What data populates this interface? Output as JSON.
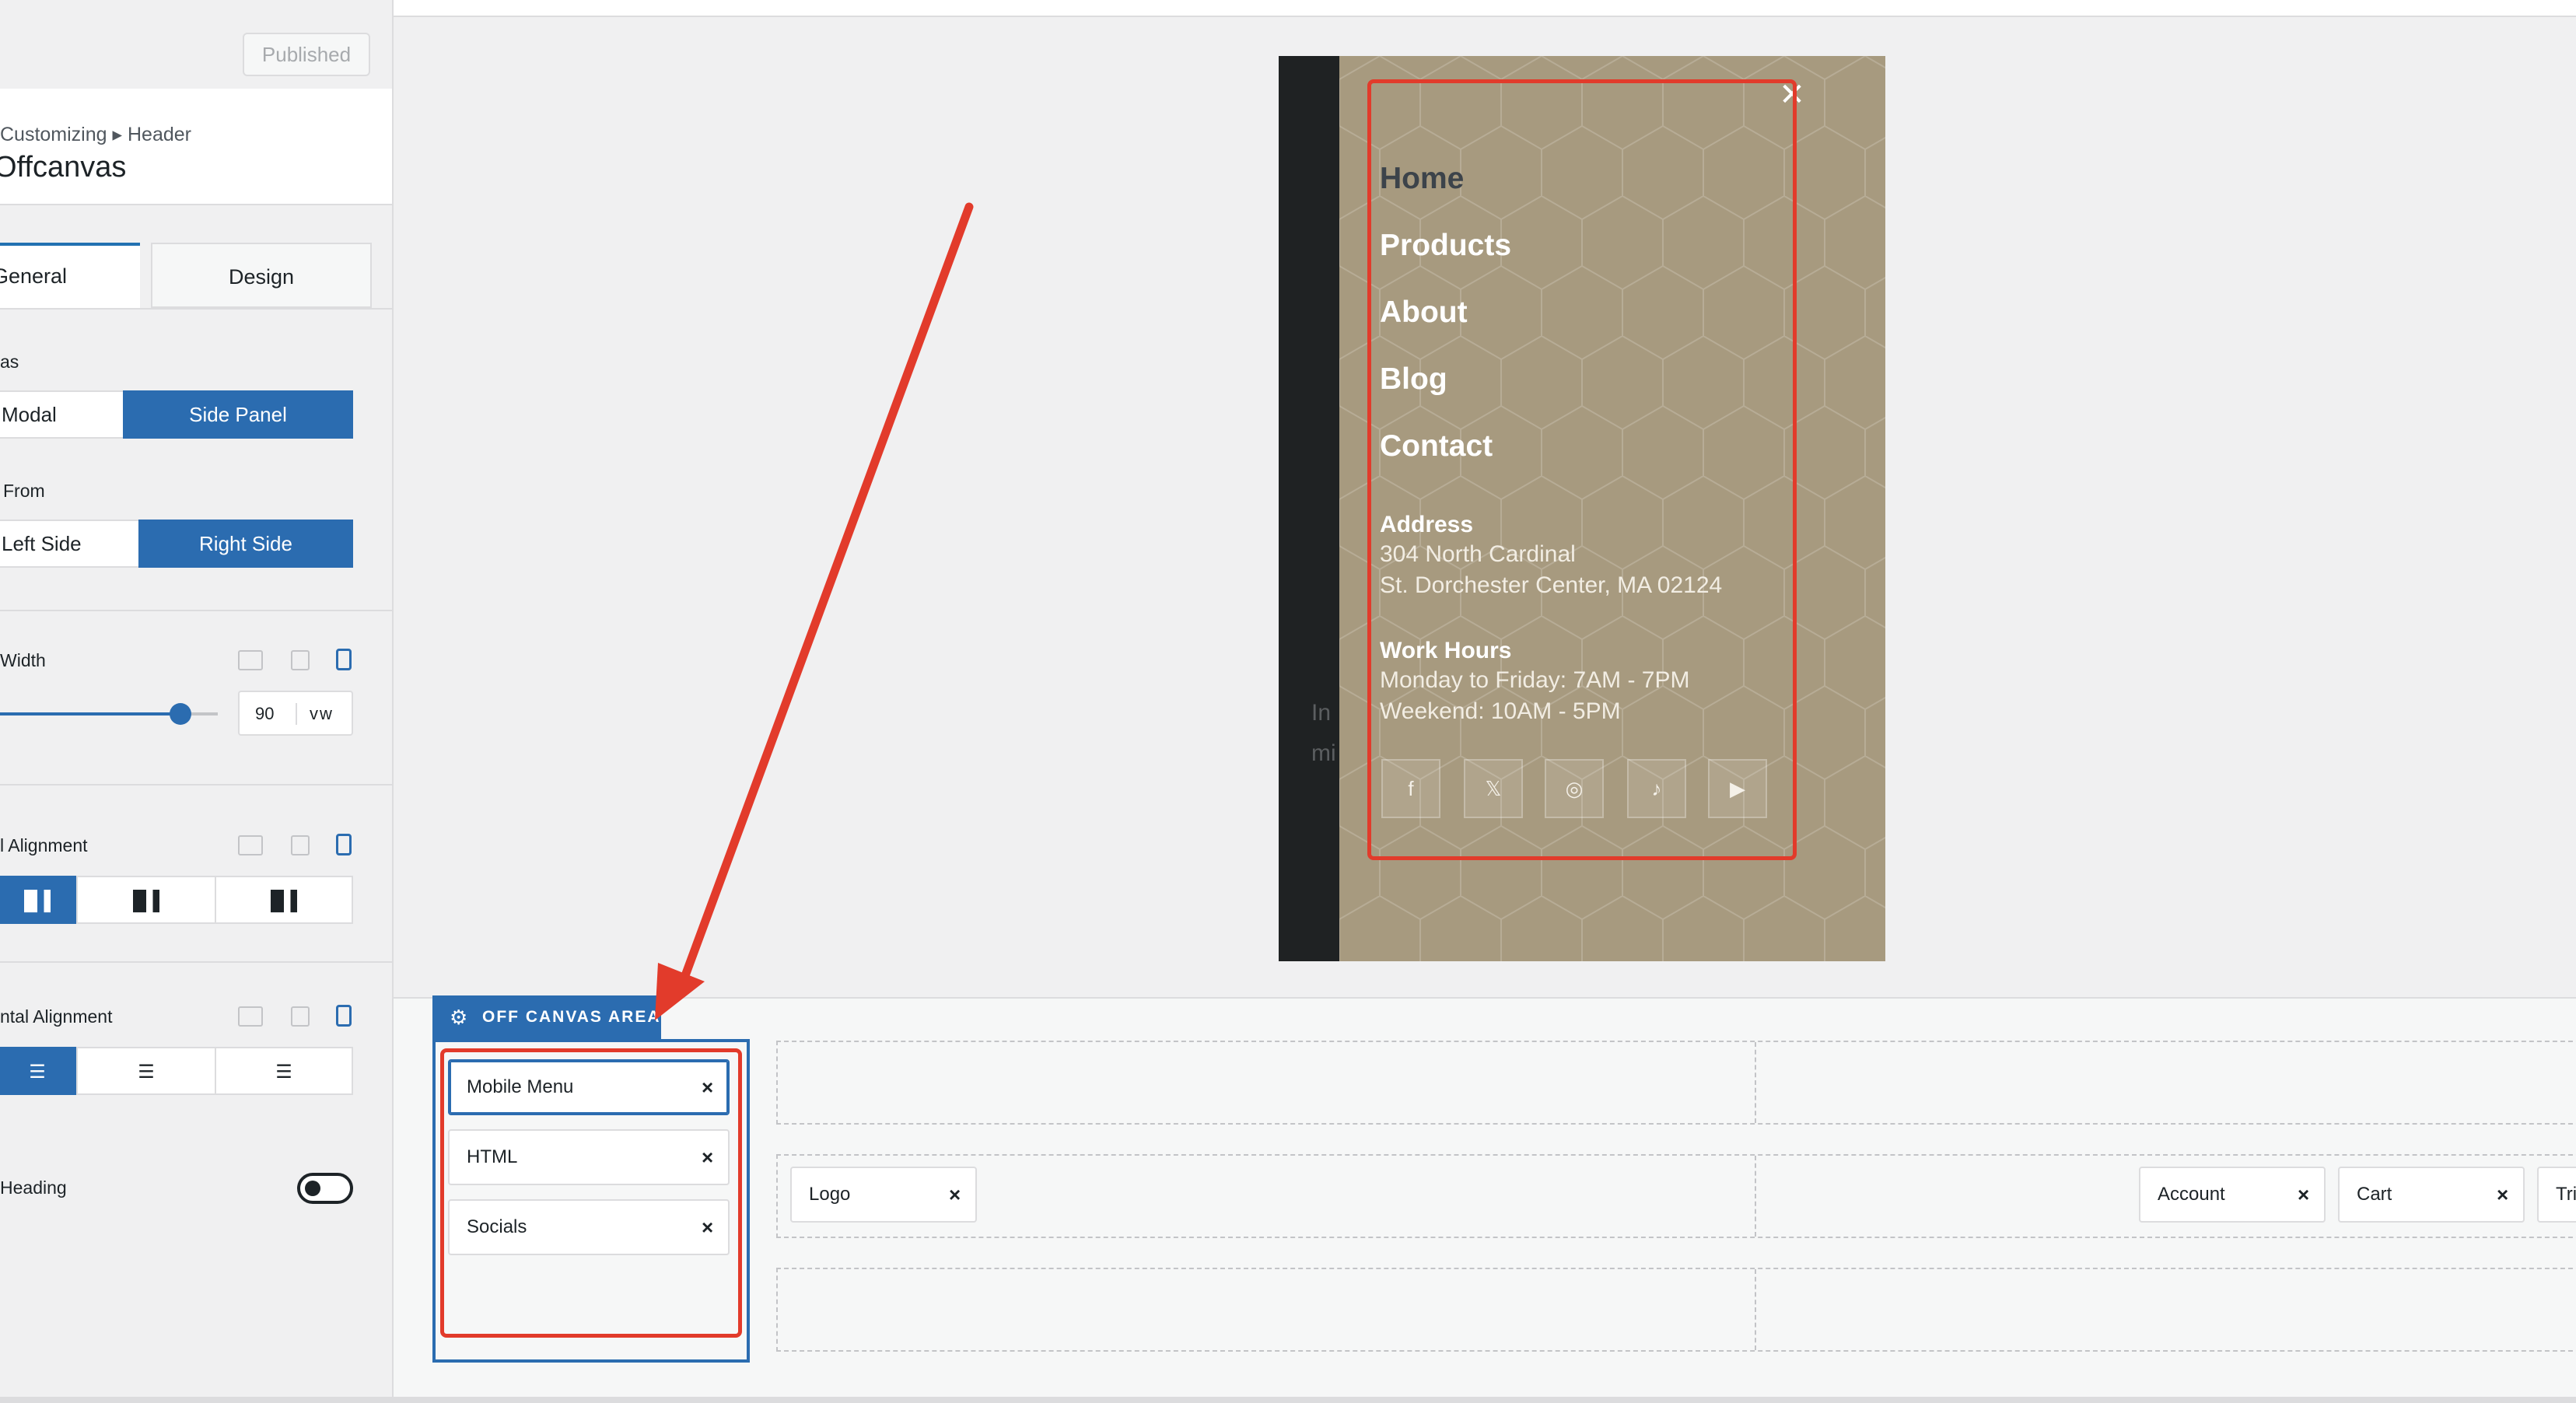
{
  "sidebar": {
    "publish_button": "Published",
    "breadcrumb": "Customizing ▸ Header",
    "panel_title": "Offcanvas",
    "tabs": [
      {
        "label": "General",
        "active": true
      },
      {
        "label": "Design",
        "active": false
      }
    ],
    "layout": {
      "label": "as",
      "options": [
        "Modal",
        "Side Panel"
      ],
      "selected": "Side Panel"
    },
    "slide_from": {
      "label": "From",
      "options": [
        "Left Side",
        "Right Side"
      ],
      "selected": "Right Side"
    },
    "width": {
      "label": "Width",
      "value": "90",
      "unit": "vw",
      "slider_fraction": 0.84
    },
    "vertical_alignment": {
      "label": "l Alignment",
      "options": [
        "align-top-icon",
        "align-middle-icon",
        "align-bottom-icon"
      ],
      "selected_index": 0
    },
    "horizontal_alignment": {
      "label": "ntal Alignment",
      "options": [
        "align-left-icon",
        "align-center-icon",
        "align-right-icon"
      ],
      "selected_index": 0
    },
    "heading_toggle": {
      "label": "Heading",
      "on": false
    }
  },
  "preview": {
    "close_icon": "✕",
    "ghost_text": [
      "In",
      "mi"
    ],
    "menu": [
      "Home",
      "Products",
      "About",
      "Blog",
      "Contact"
    ],
    "address": {
      "heading": "Address",
      "lines": [
        "304 North Cardinal",
        "St. Dorchester Center, MA 02124"
      ]
    },
    "hours": {
      "heading": "Work Hours",
      "lines": [
        "Monday to Friday: 7AM - 7PM",
        "Weekend: 10AM - 5PM"
      ]
    },
    "socials": [
      "facebook-icon",
      "x-twitter-icon",
      "instagram-icon",
      "tiktok-icon",
      "youtube-icon"
    ],
    "panel_color": "#a79a7f"
  },
  "builder": {
    "off_canvas_label": "OFF CANVAS AREA",
    "off_canvas_items": [
      "Mobile Menu",
      "HTML",
      "Socials"
    ],
    "main_row_left": [
      "Logo"
    ],
    "main_row_right": [
      "Account",
      "Cart",
      "Tri"
    ],
    "remove_glyph": "×",
    "accent_color": "#2b6cb0",
    "annotation_color": "#e23b2b"
  }
}
